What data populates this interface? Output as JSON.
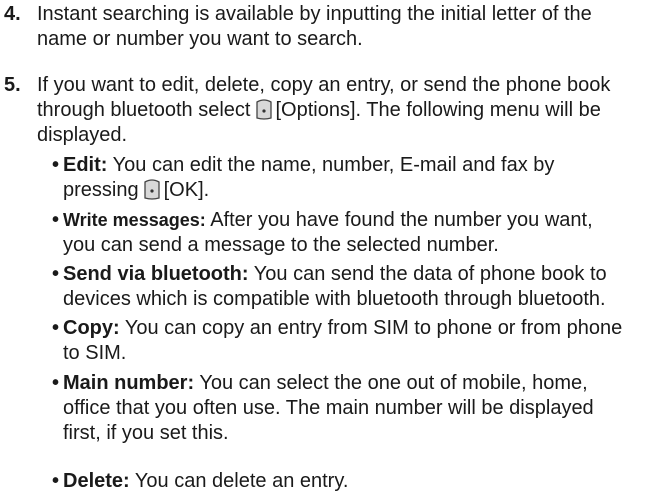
{
  "steps": [
    {
      "number": "4.",
      "lines": [
        "Instant searching is available by inputting the initial letter of the",
        "name or number you want to search."
      ]
    },
    {
      "number": "5.",
      "line1": "If you want to edit, delete, copy an entry, or send the phone book",
      "line2_before": "through bluetooth select",
      "line2_after": "[Options]. The following menu will be",
      "line3": "displayed."
    }
  ],
  "bullets": [
    {
      "term": "Edit:",
      "line1": "You can edit the name, number, E-mail and fax by",
      "line2_before": "pressing",
      "line2_after": "[OK]."
    },
    {
      "term": "Write messages:",
      "line1": "After you have found the number you want,",
      "line2": "you can send a message to the selected number."
    },
    {
      "term": "Send via bluetooth:",
      "line1": "You can send the data of phone book to",
      "line2": "devices which is compatible with bluetooth through bluetooth."
    },
    {
      "term": "Copy:",
      "line1": "You can copy an entry from SIM to phone or from phone",
      "line2": "to SIM."
    },
    {
      "term": "Main number:",
      "line1": "You can select the one out of mobile, home,",
      "line2": "office that you often use. The main number will be displayed",
      "line3": "first, if you set this."
    },
    {
      "term": "Delete:",
      "line1": "You can delete an entry."
    }
  ],
  "icons": {
    "softkey": "left-softkey-icon",
    "softkey_fill": "#d8d8d8",
    "softkey_stroke": "#444444"
  }
}
